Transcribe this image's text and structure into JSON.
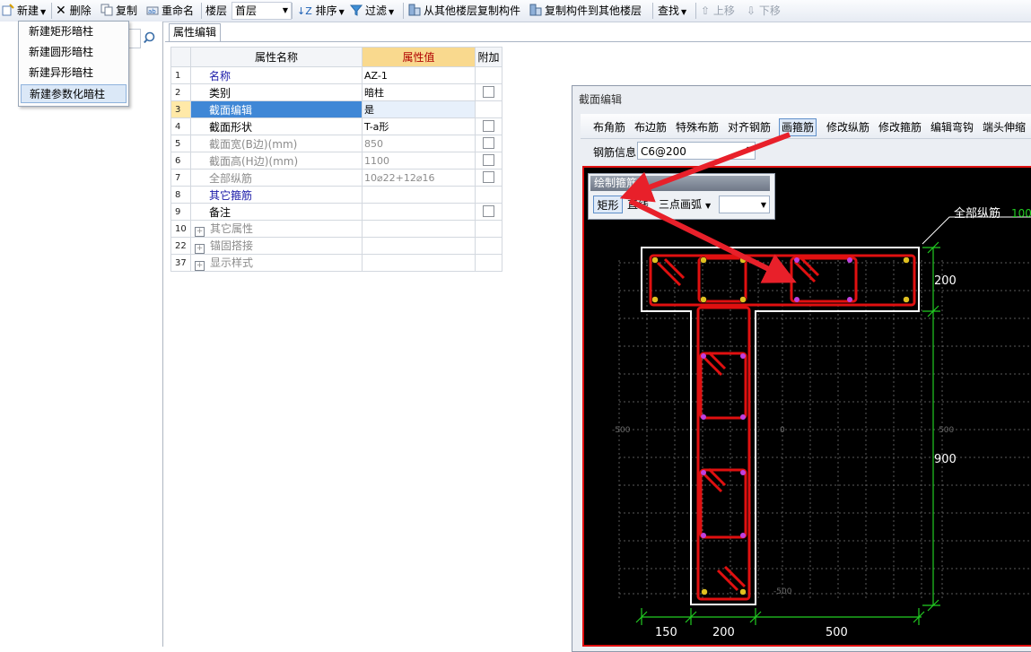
{
  "toolbar": {
    "new": "新建",
    "delete": "删除",
    "copy": "复制",
    "rename": "重命名",
    "floor_label": "楼层",
    "floor_value": "首层",
    "sort": "排序",
    "filter": "过滤",
    "copy_from_floor": "从其他楼层复制构件",
    "copy_to_floor": "复制构件到其他楼层",
    "find": "查找",
    "move_up": "上移",
    "move_down": "下移"
  },
  "new_menu": {
    "items": [
      "新建矩形暗柱",
      "新建圆形暗柱",
      "新建异形暗柱",
      "新建参数化暗柱"
    ],
    "selected_index": 3
  },
  "tab": {
    "label": "属性编辑"
  },
  "property_grid": {
    "headers": {
      "name": "属性名称",
      "value": "属性值",
      "extra": "附加"
    },
    "rows": [
      {
        "num": "1",
        "name": "名称",
        "value": "AZ-1",
        "style": "blue",
        "checkbox": false,
        "expand": false
      },
      {
        "num": "2",
        "name": "类别",
        "value": "暗柱",
        "style": "black",
        "checkbox": true,
        "expand": false
      },
      {
        "num": "3",
        "name": "截面编辑",
        "value": "是",
        "style": "selected",
        "checkbox": false,
        "expand": false
      },
      {
        "num": "4",
        "name": "截面形状",
        "value": "T-a形",
        "style": "black",
        "checkbox": true,
        "expand": false
      },
      {
        "num": "5",
        "name": "截面宽(B边)(mm)",
        "value": "850",
        "style": "gray",
        "checkbox": true,
        "expand": false
      },
      {
        "num": "6",
        "name": "截面高(H边)(mm)",
        "value": "1100",
        "style": "gray",
        "checkbox": true,
        "expand": false
      },
      {
        "num": "7",
        "name": "全部纵筋",
        "value": "10⌀22+12⌀16",
        "style": "gray",
        "checkbox": true,
        "expand": false
      },
      {
        "num": "8",
        "name": "其它箍筋",
        "value": "",
        "style": "blue",
        "checkbox": false,
        "expand": false
      },
      {
        "num": "9",
        "name": "备注",
        "value": "",
        "style": "black",
        "checkbox": true,
        "expand": false
      },
      {
        "num": "10",
        "name": "其它属性",
        "value": "",
        "style": "gray",
        "checkbox": false,
        "expand": true
      },
      {
        "num": "22",
        "name": "锚固搭接",
        "value": "",
        "style": "gray",
        "checkbox": false,
        "expand": true
      },
      {
        "num": "37",
        "name": "显示样式",
        "value": "",
        "style": "gray",
        "checkbox": false,
        "expand": true
      }
    ]
  },
  "section_editor": {
    "title": "截面编辑",
    "tools": [
      "布角筋",
      "布边筋",
      "特殊布筋",
      "对齐钢筋",
      "画箍筋",
      "修改纵筋",
      "修改箍筋",
      "编辑弯钩",
      "端头伸缩"
    ],
    "active_tool": "画箍筋",
    "rebar_info_label": "钢筋信息",
    "rebar_info_value": "C6@200",
    "palette": {
      "title": "绘制箍筋",
      "buttons": [
        "矩形",
        "直线",
        "三点画弧"
      ]
    },
    "canvas": {
      "all_rebar_label": "全部纵筋",
      "all_rebar_value": "100",
      "dim_right_top": "200",
      "dim_right_mid": "900",
      "dim_bottom": [
        "150",
        "200",
        "500"
      ],
      "grid_labels": {
        "left": "-500",
        "center": "0",
        "right": "500",
        "bottom": "-500"
      }
    }
  },
  "colors": {
    "canvas_bg": "#000000",
    "outline": "#ffffff",
    "stirrup": "#e01010",
    "dimension": "#22cc22",
    "arrow": "#e8202a",
    "value_header": "#f9d98e"
  }
}
